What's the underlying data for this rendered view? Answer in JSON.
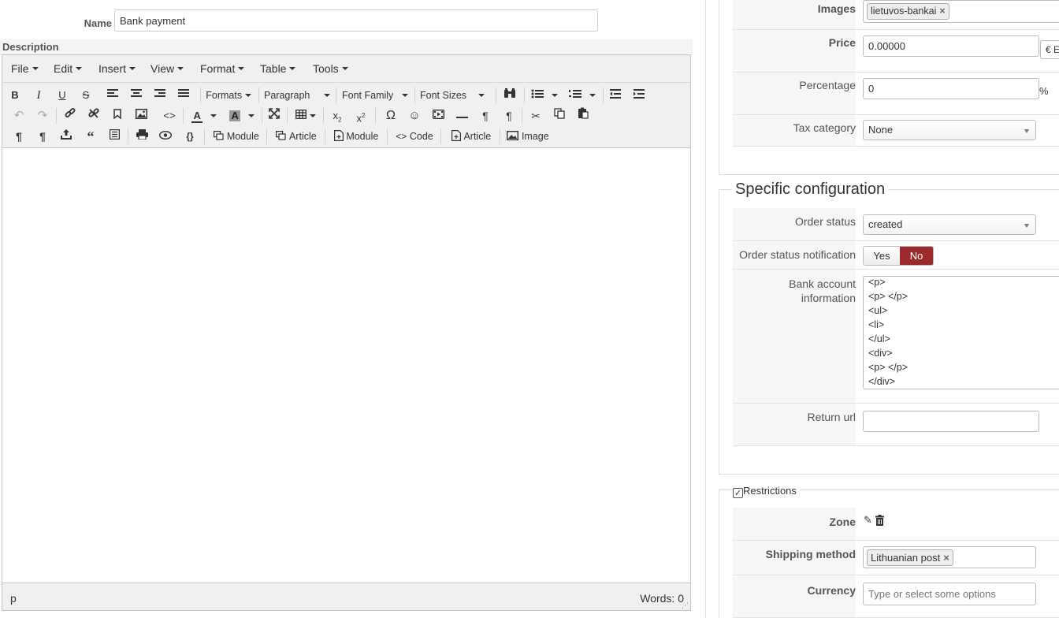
{
  "form": {
    "name_label": "Name",
    "name_value": "Bank payment",
    "description_label": "Description"
  },
  "editor": {
    "menus": [
      "File",
      "Edit",
      "Insert",
      "View",
      "Format",
      "Table",
      "Tools"
    ],
    "toolbar": {
      "formats": "Formats",
      "paragraph": "Paragraph",
      "font_family": "Font Family",
      "font_sizes": "Font Sizes",
      "module1": "Module",
      "article1": "Article",
      "module2": "Module",
      "code": "Code",
      "article2": "Article",
      "image": "Image"
    },
    "status_path": "p",
    "words": "Words: 0"
  },
  "right": {
    "images_label": "Images",
    "images_chip": "lietuvos-bankai",
    "price_label": "Price",
    "price_value": "0.00000",
    "currency_btn": "€ E",
    "percentage_label": "Percentage",
    "percentage_value": "0",
    "percentage_unit": "%",
    "tax_label": "Tax category",
    "tax_value": "None",
    "specific_title": "Specific configuration",
    "order_status_label": "Order status",
    "order_status_value": "created",
    "notification_label": "Order status notification",
    "yes": "Yes",
    "no": "No",
    "bank_label_1": "Bank account",
    "bank_label_2": "information",
    "bank_lines": [
      "<p>",
      "<p> </p>",
      "<ul>",
      "<li>",
      "</ul>",
      "<div>",
      "<p> </p>",
      "</div>"
    ],
    "return_label": "Return url",
    "return_value": "",
    "restrictions_title": "Restrictions",
    "zone_label": "Zone",
    "shipping_label": "Shipping method",
    "shipping_chip": "Lithuanian post",
    "currency_label": "Currency",
    "currency_placeholder": "Type or select some options"
  },
  "colors": {
    "no_active": "#9d2a2a",
    "toolbar_bg": "#f0f0f0"
  }
}
